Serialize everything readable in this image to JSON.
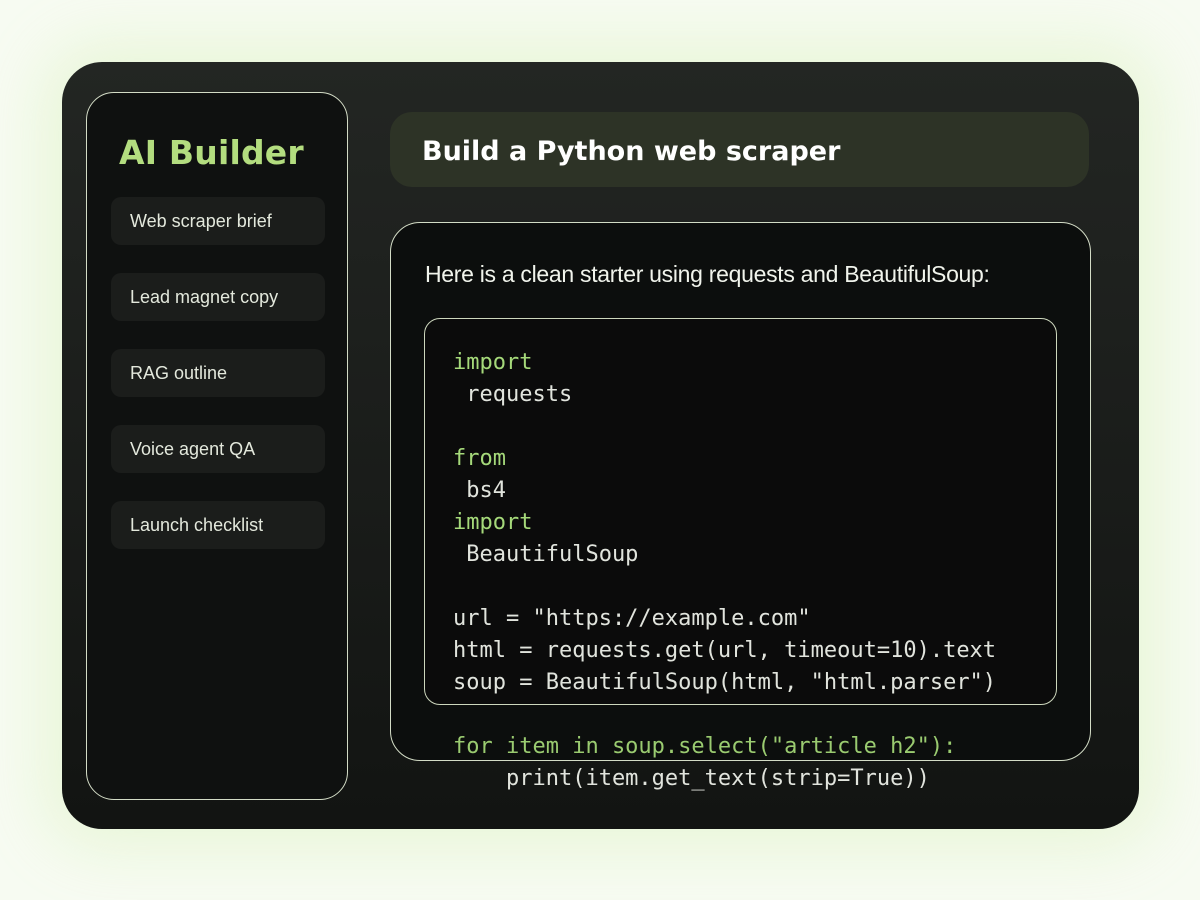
{
  "sidebar": {
    "brand": "AI Builder",
    "items": [
      {
        "label": "Web scraper brief"
      },
      {
        "label": "Lead magnet copy"
      },
      {
        "label": "RAG outline"
      },
      {
        "label": "Voice agent QA"
      },
      {
        "label": "Launch checklist"
      }
    ]
  },
  "header": {
    "title": "Build a Python web scraper"
  },
  "message": {
    "intro": "Here is a clean starter using requests and BeautifulSoup:",
    "code": {
      "lines": [
        "import",
        " requests",
        "",
        "from",
        " bs4",
        "import",
        " BeautifulSoup",
        "",
        "url = \"https://example.com\"",
        "html = requests.get(url, timeout=10).text",
        "soup = BeautifulSoup(html, \"html.parser\")",
        "",
        "for item in soup.select(\"article h2\"):",
        "    print(item.get_text(strip=True))"
      ]
    }
  },
  "colors": {
    "accent": "#b3dd7f",
    "keyword": "#a5d97a",
    "header_bg": "#2d3326",
    "panel_bg": "#0f1110",
    "page_bg": "#f7fbf2"
  }
}
